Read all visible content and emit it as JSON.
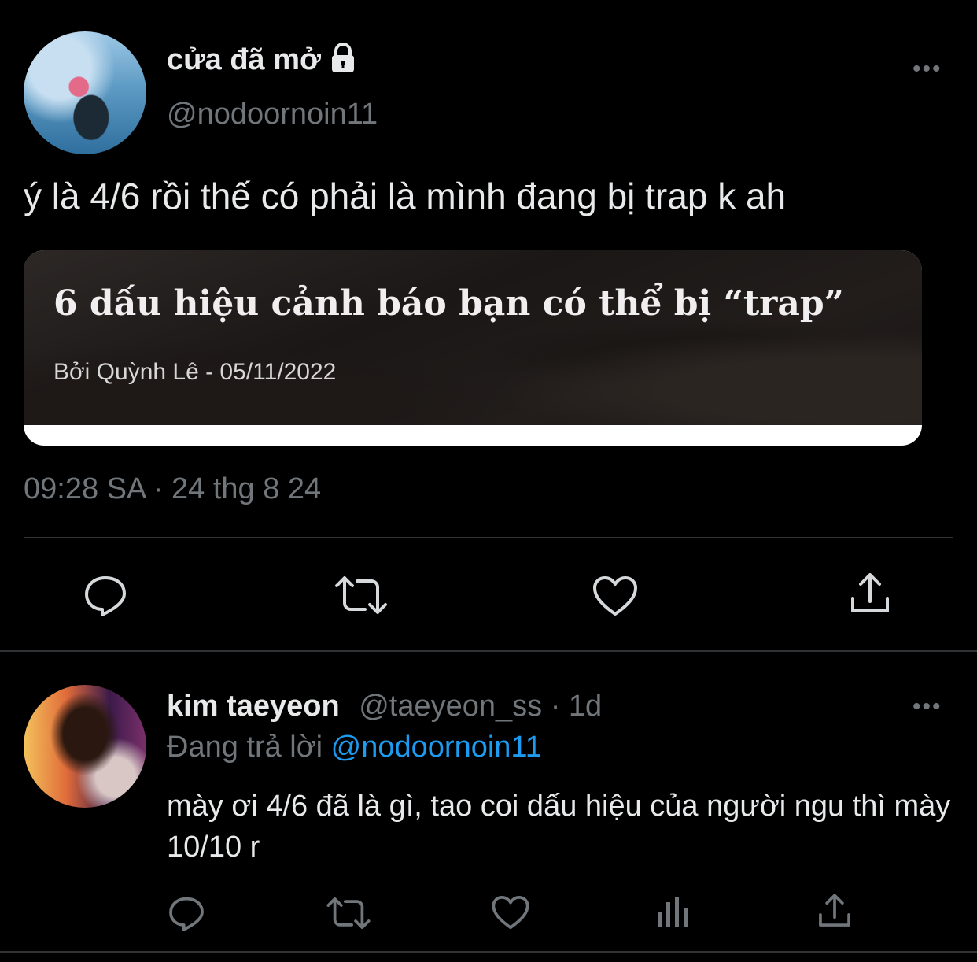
{
  "tweet": {
    "display_name": "cửa đã mở",
    "lock_icon": "lock-icon",
    "handle": "@nodoornoin11",
    "more_label": "•••",
    "text": "ý là 4/6 rồi thế có phải là mình đang bị trap k ah",
    "card": {
      "title": "6 dấu hiệu cảnh báo bạn có thể bị “trap”",
      "byline": "Bởi  Quỳnh Lê   -  05/11/2022"
    },
    "timestamp": "09:28 SA · 24 thg 8 24",
    "actions": [
      "reply-icon",
      "retweet-icon",
      "like-icon",
      "share-icon"
    ]
  },
  "reply": {
    "display_name": "kim taeyeon",
    "handle_time": "@taeyeon_ss · 1d",
    "replying_prefix": "Đang trả lời ",
    "replying_to": "@nodoornoin11",
    "more_label": "•••",
    "text": "mày ơi 4/6 đã là gì, tao coi dấu hiệu của người ngu thì mày 10/10 r",
    "actions": [
      "reply-icon",
      "retweet-icon",
      "like-icon",
      "analytics-icon",
      "share-icon"
    ]
  },
  "colors": {
    "background": "#000000",
    "text": "#e7e9ea",
    "muted": "#71767b",
    "accent": "#1d9bf0",
    "divider": "#2f3336"
  }
}
